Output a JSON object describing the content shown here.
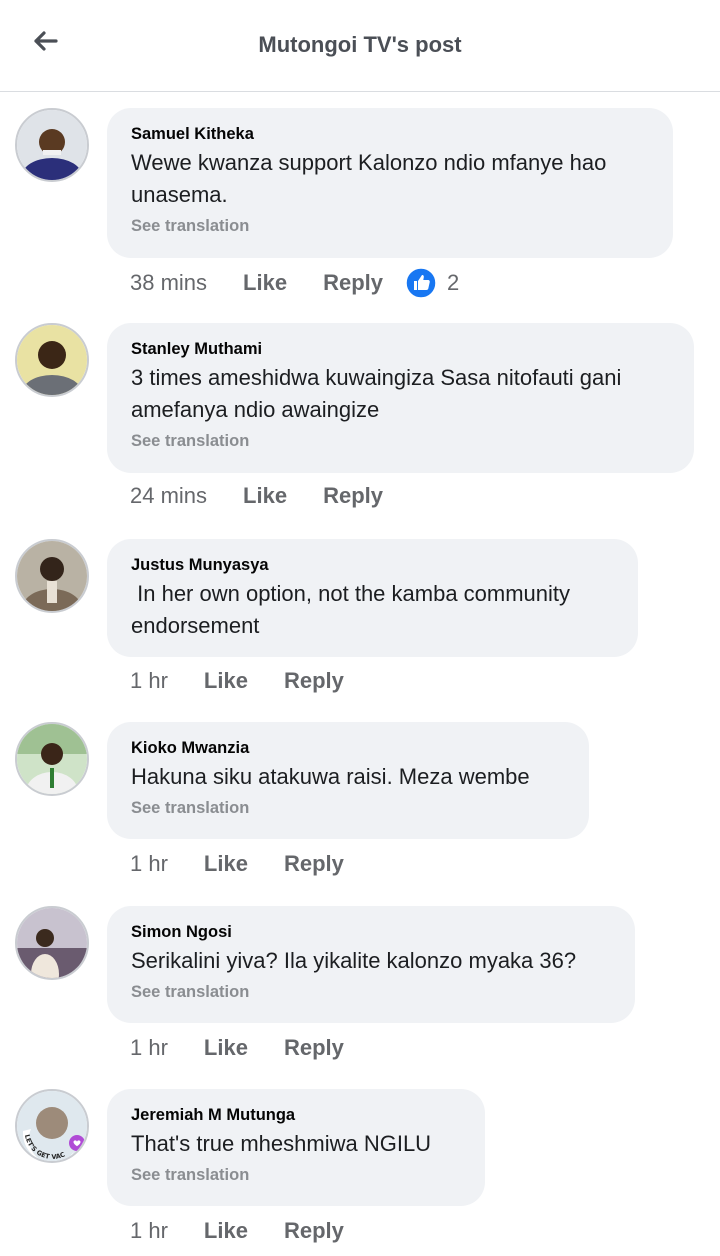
{
  "header": {
    "title": "Mutongoi TV's post"
  },
  "comments": [
    {
      "author": "Samuel Kitheka",
      "text": "Wewe kwanza support Kalonzo ndio mfanye hao unasema.",
      "see_translation": "See translation",
      "time": "38 mins",
      "like": "Like",
      "reply": "Reply",
      "reaction_count": "2"
    },
    {
      "author": "Stanley Muthami",
      "text": "3 times ameshidwa kuwaingiza Sasa nitofauti gani amefanya ndio awaingize",
      "see_translation": "See translation",
      "time": "24 mins",
      "like": "Like",
      "reply": "Reply"
    },
    {
      "author": "Justus Munyasya",
      "text": " In her own option, not the kamba community endorsement",
      "time": "1 hr",
      "like": "Like",
      "reply": "Reply"
    },
    {
      "author": "Kioko Mwanzia",
      "text": "Hakuna siku atakuwa raisi. Meza wembe",
      "see_translation": "See translation",
      "time": "1 hr",
      "like": "Like",
      "reply": "Reply"
    },
    {
      "author": "Simon Ngosi",
      "text": "Serikalini yiva? Ila yikalite kalonzo myaka 36?",
      "see_translation": "See translation",
      "time": "1 hr",
      "like": "Like",
      "reply": "Reply"
    },
    {
      "author": "Jeremiah M Mutunga",
      "text": "That's true mheshmiwa NGILU",
      "see_translation": "See translation",
      "time": "1 hr",
      "like": "Like",
      "reply": "Reply",
      "avatar_badge_text": "LET'S GET VACCINATED"
    }
  ]
}
